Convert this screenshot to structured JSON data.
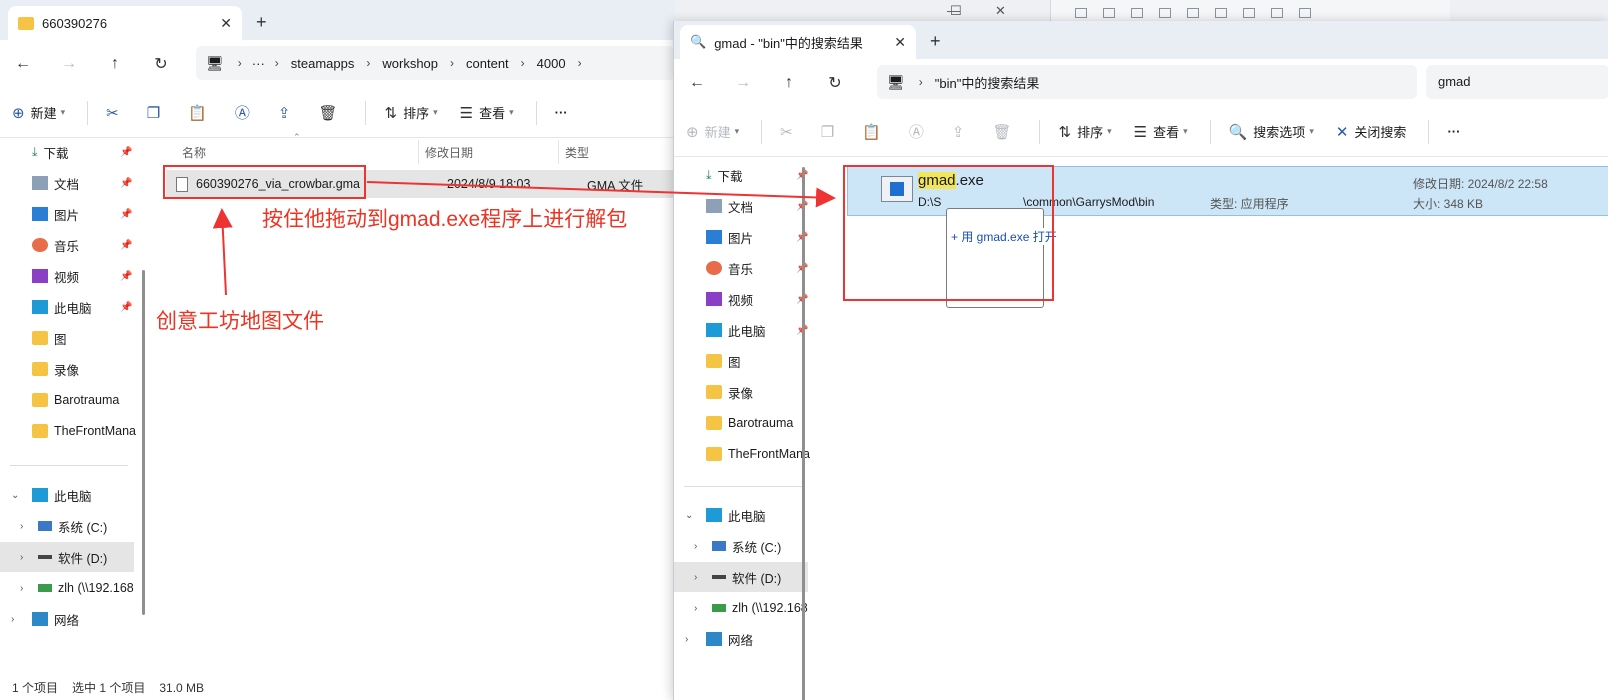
{
  "back_window": {
    "minimize": "—",
    "maximize": "☐",
    "close": "✕"
  },
  "left": {
    "tab_title": "660390276",
    "breadcrumb": [
      "steamapps",
      "workshop",
      "content",
      "4000"
    ],
    "toolbar": {
      "new_label": "新建",
      "sort_label": "排序",
      "view_label": "查看",
      "more": "···"
    },
    "quick_access": [
      {
        "label": "下载",
        "icon": "download-icon"
      },
      {
        "label": "文档",
        "icon": "document-icon"
      },
      {
        "label": "图片",
        "icon": "picture-icon"
      },
      {
        "label": "音乐",
        "icon": "music-icon"
      },
      {
        "label": "视频",
        "icon": "video-icon"
      },
      {
        "label": "此电脑",
        "icon": "computer-icon"
      },
      {
        "label": "图",
        "icon": "folder-icon"
      },
      {
        "label": "录像",
        "icon": "folder-icon"
      },
      {
        "label": "Barotrauma",
        "icon": "folder-icon"
      },
      {
        "label": "TheFrontMana",
        "icon": "folder-icon"
      }
    ],
    "tree": [
      {
        "label": "此电脑"
      },
      {
        "label": "系统 (C:)"
      },
      {
        "label": "软件 (D:)"
      },
      {
        "label": "zlh (\\\\192.168"
      },
      {
        "label": "网络"
      }
    ],
    "columns": {
      "name": "名称",
      "date": "修改日期",
      "type": "类型"
    },
    "file": {
      "name": "660390276_via_crowbar.gma",
      "date": "2024/8/9 18:03",
      "type": "GMA 文件"
    },
    "status": {
      "count": "1 个项目",
      "selected": "选中 1 个项目",
      "size": "31.0 MB"
    }
  },
  "right": {
    "tab_title": "gmad - \"bin\"中的搜索结果",
    "breadcrumb": "\"bin\"中的搜索结果",
    "search_value": "gmad",
    "toolbar": {
      "new_label": "新建",
      "sort_label": "排序",
      "view_label": "查看",
      "search_options": "搜索选项",
      "close_search": "关闭搜索",
      "more": "···"
    },
    "quick_access": [
      {
        "label": "下载"
      },
      {
        "label": "文档"
      },
      {
        "label": "图片"
      },
      {
        "label": "音乐"
      },
      {
        "label": "视频"
      },
      {
        "label": "此电脑"
      },
      {
        "label": "图"
      },
      {
        "label": "录像"
      },
      {
        "label": "Barotrauma"
      },
      {
        "label": "TheFrontMana"
      }
    ],
    "tree": [
      {
        "label": "此电脑"
      },
      {
        "label": "系统 (C:)"
      },
      {
        "label": "软件 (D:)"
      },
      {
        "label": "zlh (\\\\192.168"
      },
      {
        "label": "网络"
      }
    ],
    "result": {
      "name_hl": "gmad",
      "name_rest": ".exe",
      "path_start": "D:\\S",
      "path_end": "\\common\\GarrysMod\\bin",
      "type": "类型: 应用程序",
      "date": "修改日期: 2024/8/2 22:58",
      "size": "大小: 348 KB"
    },
    "drag_tooltip": "+ 用 gmad.exe 打开"
  },
  "annotations": {
    "drag_hint": "按住他拖动到gmad.exe程序上进行解包",
    "file_hint": "创意工坊地图文件"
  },
  "colors": {
    "annotation": "#e33",
    "selection": "#cce6f7",
    "folder": "#f6c445"
  }
}
